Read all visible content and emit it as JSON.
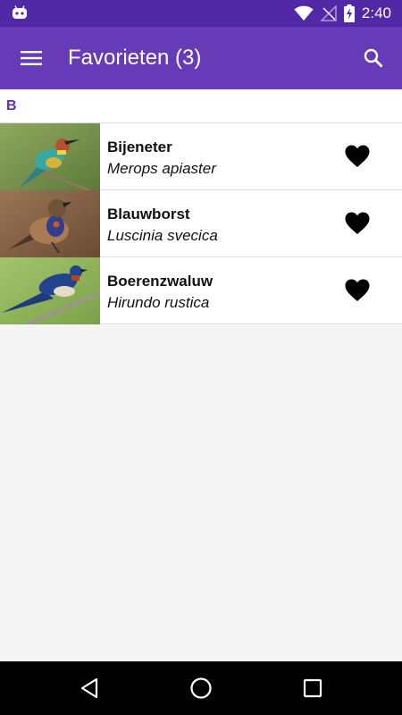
{
  "status_bar": {
    "time": "2:40",
    "icons": [
      "android-icon",
      "wifi-icon",
      "signal-icon",
      "battery-charging-icon"
    ]
  },
  "app_bar": {
    "title": "Favorieten (3)",
    "icons": [
      "menu-icon",
      "search-icon"
    ]
  },
  "colors": {
    "status_bar": "#5128a6",
    "app_bar": "#673ab7",
    "accent": "#5b2fb0"
  },
  "section": {
    "letter": "B"
  },
  "items": [
    {
      "name": "Bijeneter",
      "latin": "Merops apiaster",
      "favorite": true,
      "thumbnail": "bee-eater-photo"
    },
    {
      "name": "Blauwborst",
      "latin": "Luscinia svecica",
      "favorite": true,
      "thumbnail": "bluethroat-photo"
    },
    {
      "name": "Boerenzwaluw",
      "latin": "Hirundo rustica",
      "favorite": true,
      "thumbnail": "barn-swallow-photo"
    }
  ],
  "nav_bar": {
    "icons": [
      "back-icon",
      "home-icon",
      "recents-icon"
    ]
  }
}
